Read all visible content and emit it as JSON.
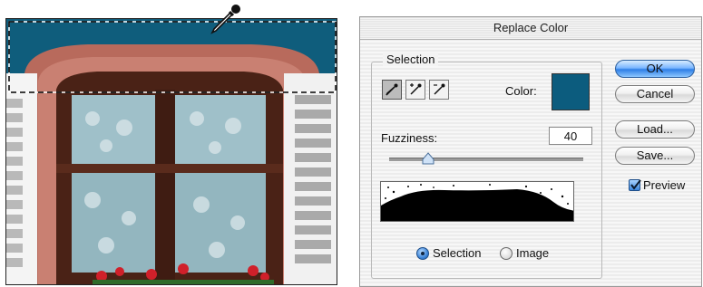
{
  "dialog": {
    "title": "Replace Color",
    "selection_group_label": "Selection",
    "color_label": "Color:",
    "selected_color": "#0c5c7e",
    "fuzziness_label": "Fuzziness:",
    "fuzziness_value": "40",
    "fuzziness_level": 0.2,
    "tools": [
      {
        "name": "eyedropper-tool",
        "icon": "eyedropper-icon",
        "active": true
      },
      {
        "name": "eyedropper-plus-tool",
        "icon": "eyedropper-plus-icon",
        "active": false
      },
      {
        "name": "eyedropper-minus-tool",
        "icon": "eyedropper-minus-icon",
        "active": false
      }
    ],
    "view_options": {
      "selection_label": "Selection",
      "image_label": "Image",
      "selected": "Selection"
    },
    "buttons": {
      "ok_label": "OK",
      "cancel_label": "Cancel",
      "load_label": "Load...",
      "save_label": "Save..."
    },
    "preview": {
      "label": "Preview",
      "checked": true
    }
  },
  "photo": {
    "subject": "window-photo",
    "cursor_icon": "eyedropper-cursor-icon"
  }
}
